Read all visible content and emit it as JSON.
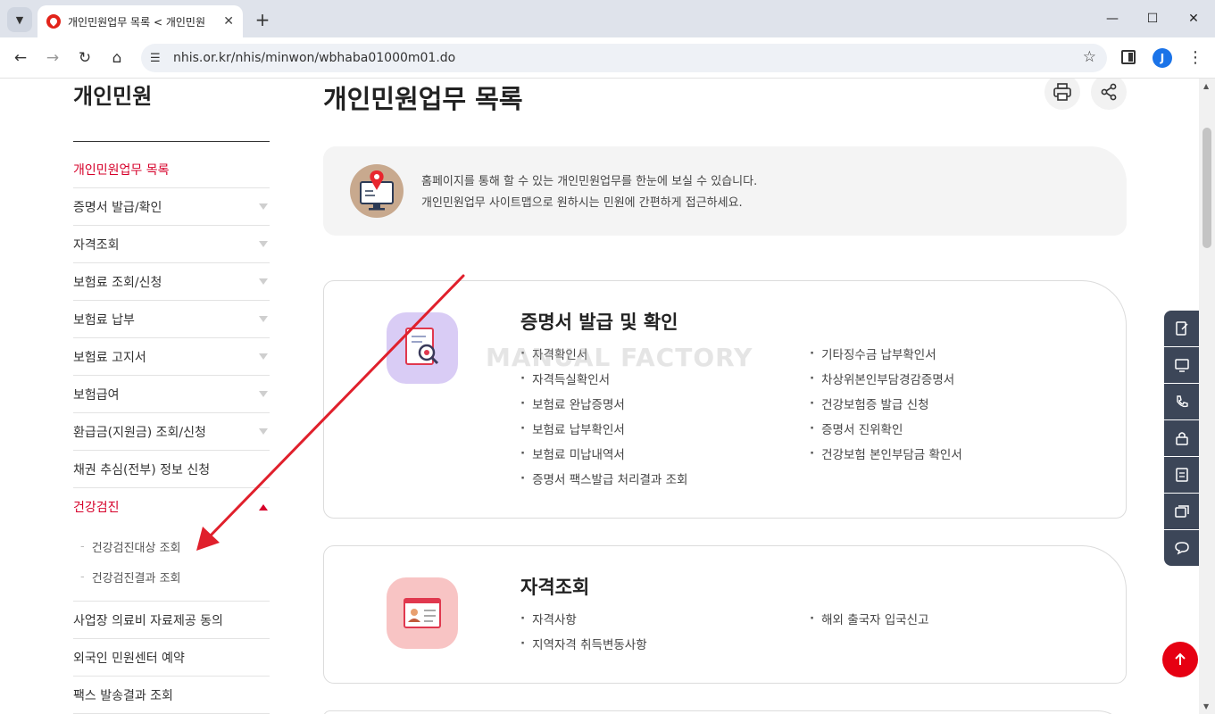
{
  "browser": {
    "tab_title": "개인민원업무 목록 < 개인민원",
    "url": "nhis.or.kr/nhis/minwon/wbhaba01000m01.do",
    "profile_initial": "J"
  },
  "sidebar": {
    "title": "개인민원",
    "items": [
      {
        "label": "개인민원업무 목록"
      },
      {
        "label": "증명서 발급/확인"
      },
      {
        "label": "자격조회"
      },
      {
        "label": "보험료 조회/신청"
      },
      {
        "label": "보험료 납부"
      },
      {
        "label": "보험료 고지서"
      },
      {
        "label": "보험급여"
      },
      {
        "label": "환급금(지원금) 조회/신청"
      },
      {
        "label": "채권 추심(전부) 정보 신청"
      },
      {
        "label": "건강검진"
      },
      {
        "label": "사업장 의료비 자료제공 동의"
      },
      {
        "label": "외국인 민원센터 예약"
      },
      {
        "label": "팩스 발송결과 조회"
      }
    ],
    "subitems": [
      {
        "label": "건강검진대상 조회"
      },
      {
        "label": "건강검진결과 조회"
      }
    ]
  },
  "main": {
    "title": "개인민원업무 목록",
    "notice": {
      "line1": "홈페이지를 통해 할 수 있는 개인민원업무를 한눈에 보실 수 있습니다.",
      "line2": "개인민원업무 사이트맵으로 원하시는 민원에 간편하게 접근하세요."
    },
    "watermark": "MANUAL FACTORY",
    "cards": [
      {
        "title": "증명서 발급 및 확인",
        "items": [
          "자격확인서",
          "기타징수금 납부확인서",
          "자격득실확인서",
          "차상위본인부담경감증명서",
          "보험료 완납증명서",
          "건강보험증 발급 신청",
          "보험료 납부확인서",
          "증명서 진위확인",
          "보험료 미납내역서",
          "건강보험 본인부담금 확인서",
          "증명서 팩스발급 처리결과 조회"
        ]
      },
      {
        "title": "자격조회",
        "items": [
          "자격사항",
          "해외 출국자 입국신고",
          "지역자격 취득변동사항"
        ]
      }
    ]
  },
  "colors": {
    "accent": "#d6002a",
    "quick_menu": "#3c4658",
    "top_button": "#e60012",
    "annotation_arrow": "#e0202c"
  }
}
